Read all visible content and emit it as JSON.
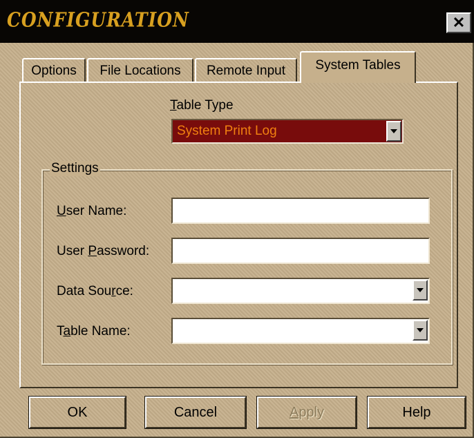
{
  "window": {
    "title": "CONFIGURATION",
    "close_glyph": "✕"
  },
  "tabs": [
    {
      "label": "Options",
      "active": false
    },
    {
      "label": "File Locations",
      "active": false
    },
    {
      "label": "Remote Input",
      "active": false
    },
    {
      "label": "System Tables",
      "active": true
    }
  ],
  "table_type": {
    "label_prefix": "T",
    "label_rest": "able Type",
    "selected": "System Print Log"
  },
  "settings": {
    "legend": "Settings",
    "user_name": {
      "label_prefix": "U",
      "label_rest": "ser Name:",
      "value": ""
    },
    "user_password": {
      "label_pre": "User ",
      "label_ul": "P",
      "label_post": "assword:",
      "value": ""
    },
    "data_source": {
      "label_pre": "Data Sou",
      "label_ul": "r",
      "label_post": "ce:",
      "value": ""
    },
    "table_name": {
      "label_pre": "T",
      "label_ul": "a",
      "label_post": "ble Name:",
      "value": ""
    }
  },
  "buttons": {
    "ok": "OK",
    "cancel": "Cancel",
    "apply_ul": "A",
    "apply_rest": "pply",
    "help": "Help"
  },
  "colors": {
    "dialog_bg": "#c6b08c",
    "title_bg": "#080604",
    "title_text": "#d8a020",
    "combo_bg": "#780c0c",
    "combo_text": "#f08010"
  }
}
